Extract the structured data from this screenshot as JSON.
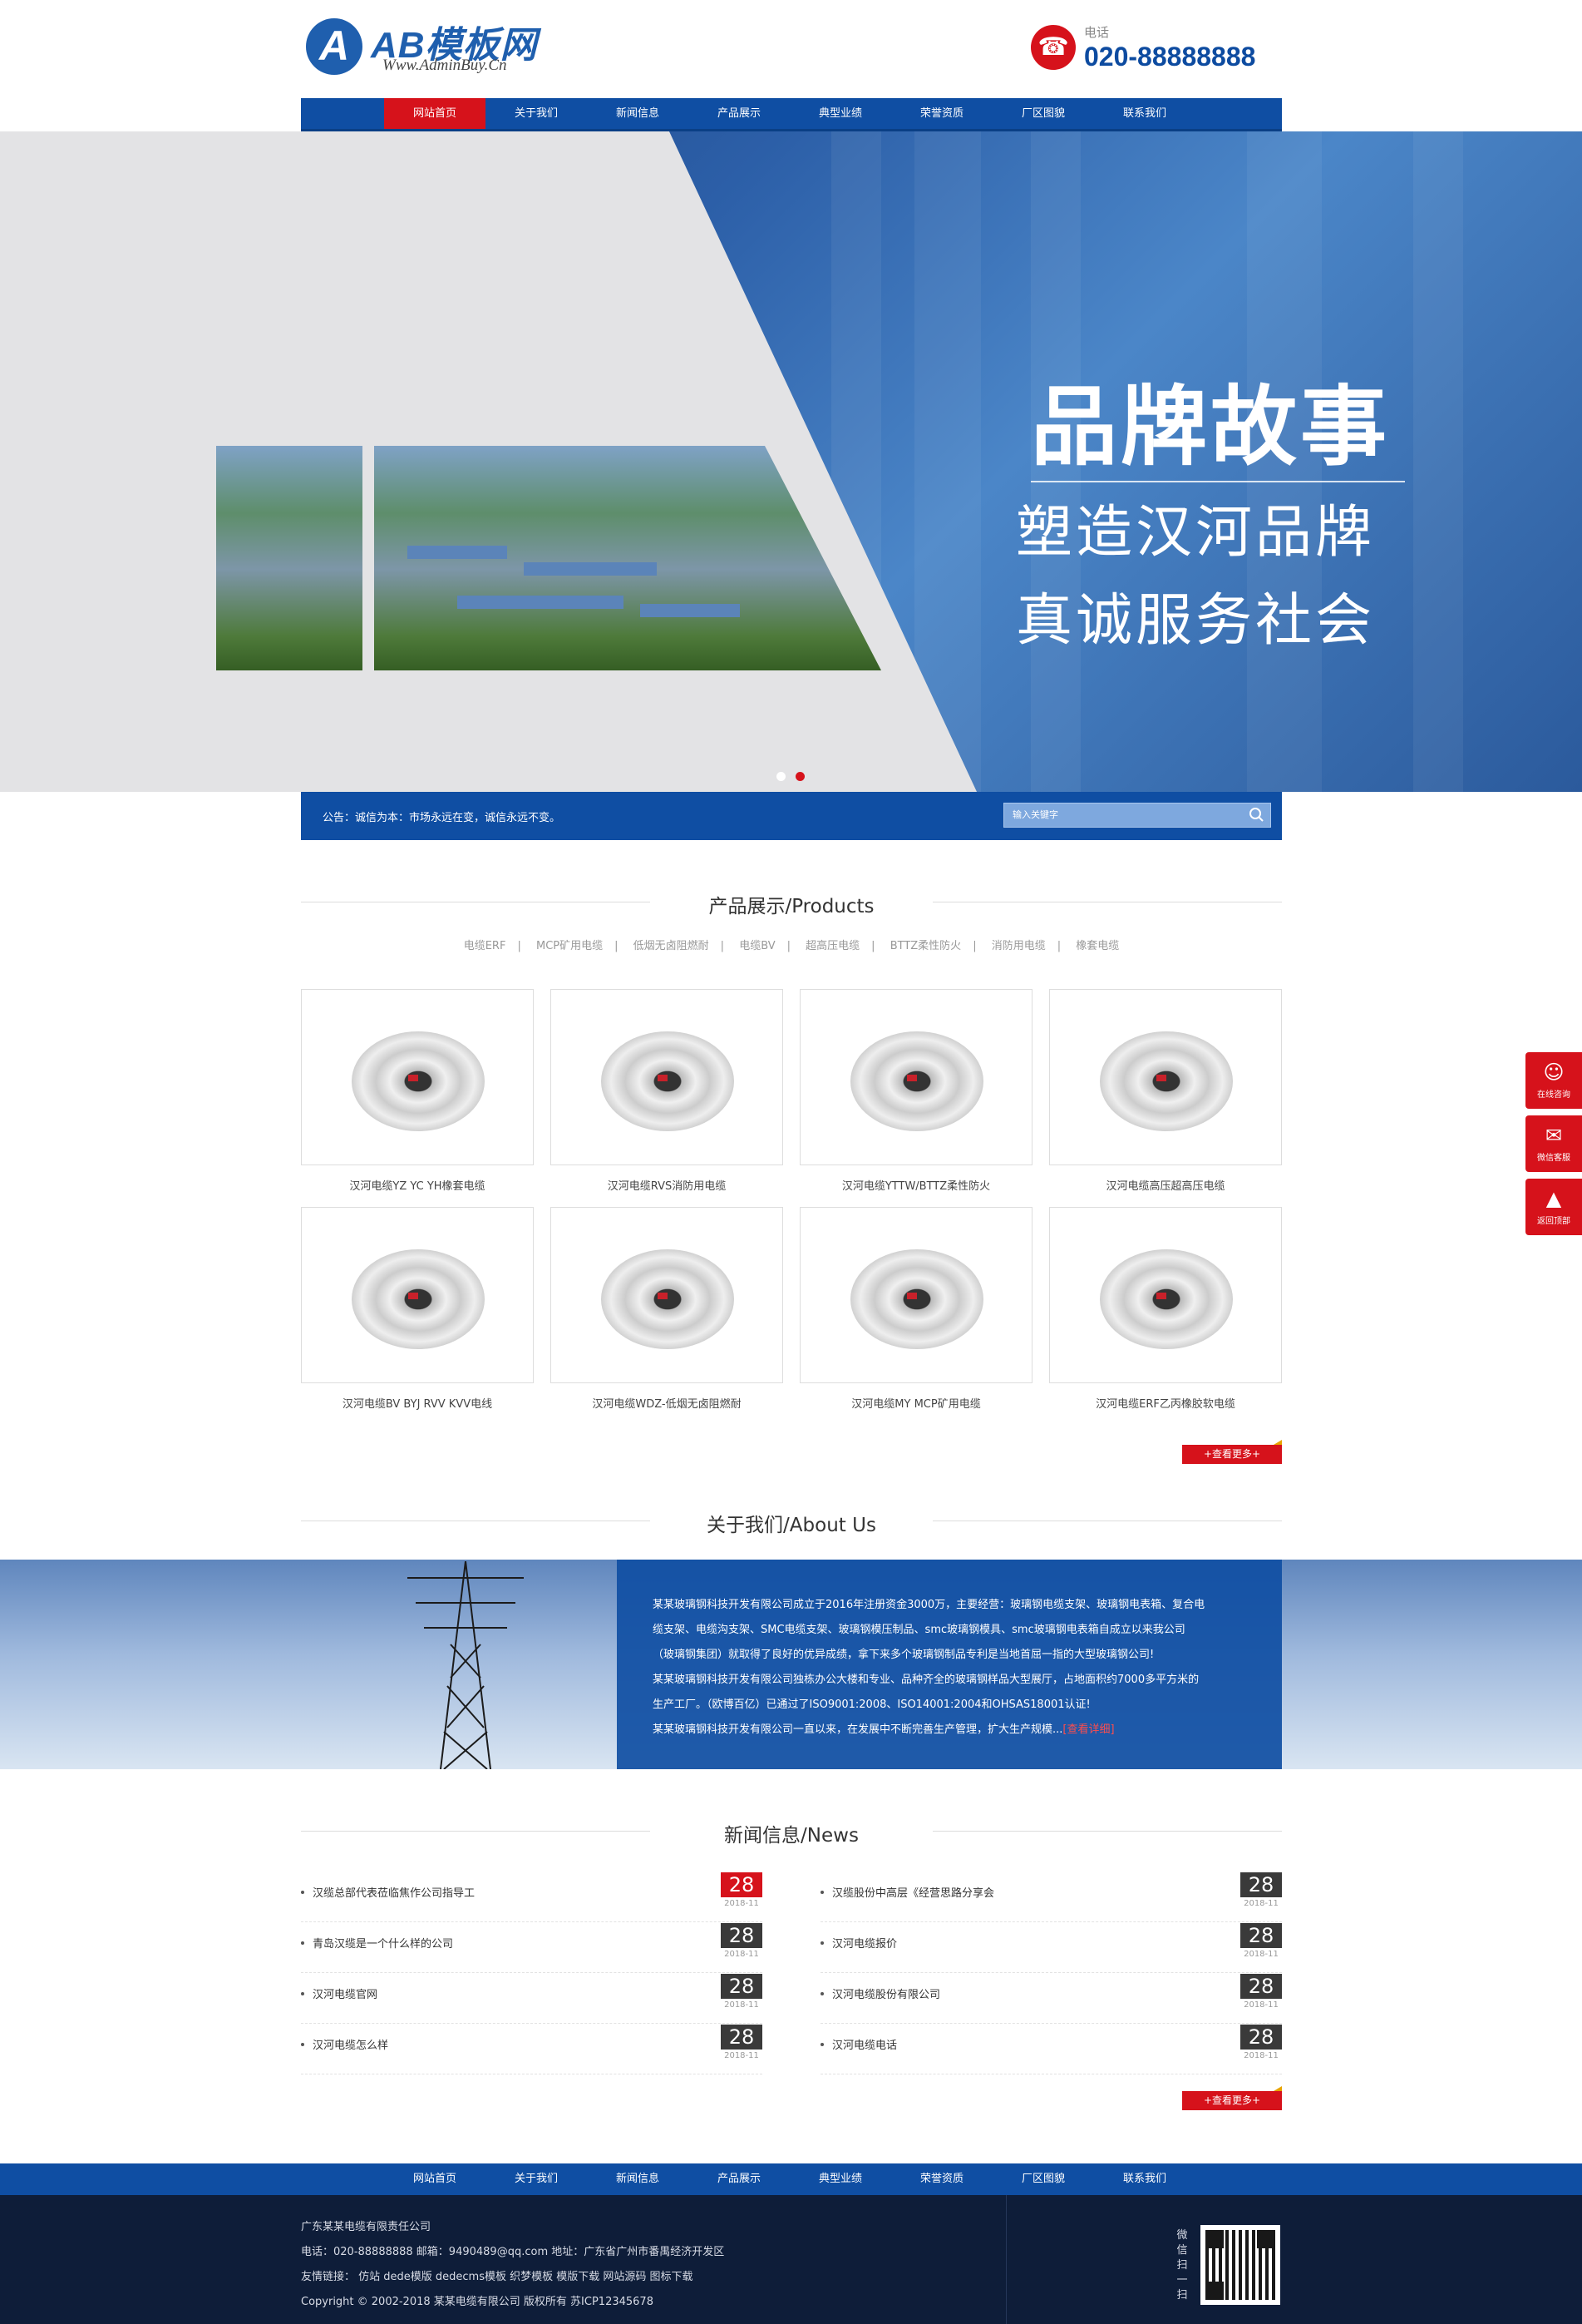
{
  "header": {
    "logo_mark": "A",
    "logo_text": "AB模板网",
    "logo_url": "Www.AdminBuy.Cn",
    "phone_label": "电话",
    "phone_number": "020-88888888"
  },
  "nav": [
    {
      "label": "网站首页",
      "active": true
    },
    {
      "label": "关于我们"
    },
    {
      "label": "新闻信息"
    },
    {
      "label": "产品展示"
    },
    {
      "label": "典型业绩"
    },
    {
      "label": "荣誉资质"
    },
    {
      "label": "厂区图貌"
    },
    {
      "label": "联系我们"
    }
  ],
  "banner": {
    "title": "品牌故事",
    "line1": "塑造汉河品牌",
    "line2": "真诚服务社会",
    "slides": 2,
    "active_slide": 1
  },
  "notice": {
    "text": "公告：诚信为本：市场永远在变，诚信永远不变。",
    "search_placeholder": "输入关键字"
  },
  "products": {
    "title": "产品展示/Products",
    "categories": [
      "电缆ERF",
      "MCP矿用电缆",
      "低烟无卤阻燃耐",
      "电缆BV",
      "超高压电缆",
      "BTTZ柔性防火",
      "消防用电缆",
      "橡套电缆"
    ],
    "items": [
      "汉河电缆YZ YC YH橡套电缆",
      "汉河电缆RVS消防用电缆",
      "汉河电缆YTTW/BTTZ柔性防火",
      "汉河电缆高压超高压电缆",
      "汉河电缆BV BYJ RVV KVV电线",
      "汉河电缆WDZ-低烟无卤阻燃耐",
      "汉河电缆MY MCP矿用电缆",
      "汉河电缆ERF乙丙橡胶软电缆"
    ],
    "more": "+查看更多+"
  },
  "about": {
    "title": "关于我们/About Us",
    "lines": [
      "某某玻璃钢科技开发有限公司成立于2016年注册资金3000万，主要经营：玻璃钢电缆支架、玻璃钢电表箱、复合电",
      "缆支架、电缆沟支架、SMC电缆支架、玻璃钢模压制品、smc玻璃钢模具、smc玻璃钢电表箱自成立以来我公司",
      "（玻璃钢集团）就取得了良好的优异成绩，拿下来多个玻璃钢制品专利是当地首屈一指的大型玻璃钢公司!",
      "某某玻璃钢科技开发有限公司独栋办公大楼和专业、品种齐全的玻璃钢样品大型展厅，占地面积约7000多平方米的",
      "生产工厂。（欧博百亿）已通过了ISO9001:2008、ISO14001:2004和OHSAS18001认证!"
    ],
    "last_line": "某某玻璃钢科技开发有限公司一直以来，在发展中不断完善生产管理，扩大生产规模...",
    "more_link": "[查看详细]"
  },
  "news": {
    "title": "新闻信息/News",
    "left": [
      {
        "title": "汉缆总部代表莅临焦作公司指导工",
        "day": "28",
        "ym": "2018-11",
        "highlight": true
      },
      {
        "title": "青岛汉缆是一个什么样的公司",
        "day": "28",
        "ym": "2018-11"
      },
      {
        "title": "汉河电缆官网",
        "day": "28",
        "ym": "2018-11"
      },
      {
        "title": "汉河电缆怎么样",
        "day": "28",
        "ym": "2018-11"
      }
    ],
    "right": [
      {
        "title": "汉缆股份中高层《经营思路分享会",
        "day": "28",
        "ym": "2018-11"
      },
      {
        "title": "汉河电缆报价",
        "day": "28",
        "ym": "2018-11"
      },
      {
        "title": "汉河电缆股份有限公司",
        "day": "28",
        "ym": "2018-11"
      },
      {
        "title": "汉河电缆电话",
        "day": "28",
        "ym": "2018-11"
      }
    ],
    "more": "+查看更多+"
  },
  "footer": {
    "nav": [
      "网站首页",
      "关于我们",
      "新闻信息",
      "产品展示",
      "典型业绩",
      "荣誉资质",
      "厂区图貌",
      "联系我们"
    ],
    "company": "广东某某电缆有限责任公司",
    "contact": "电话：020-88888888  邮箱：9490489@qq.com  地址：广东省广州市番禺经济开发区",
    "links": "友情链接：  仿站  dede模版  dedecms模板  织梦模板  模版下载  网站源码  图标下载",
    "copyright": "Copyright © 2002-2018 某某电缆有限公司 版权所有    苏ICP12345678",
    "wechat_label": "微信扫一扫"
  },
  "side": [
    {
      "icon": "qq-icon",
      "label": "在线咨询"
    },
    {
      "icon": "wechat-icon",
      "label": "微信客服"
    },
    {
      "icon": "rocket-icon",
      "label": "返回顶部"
    }
  ]
}
